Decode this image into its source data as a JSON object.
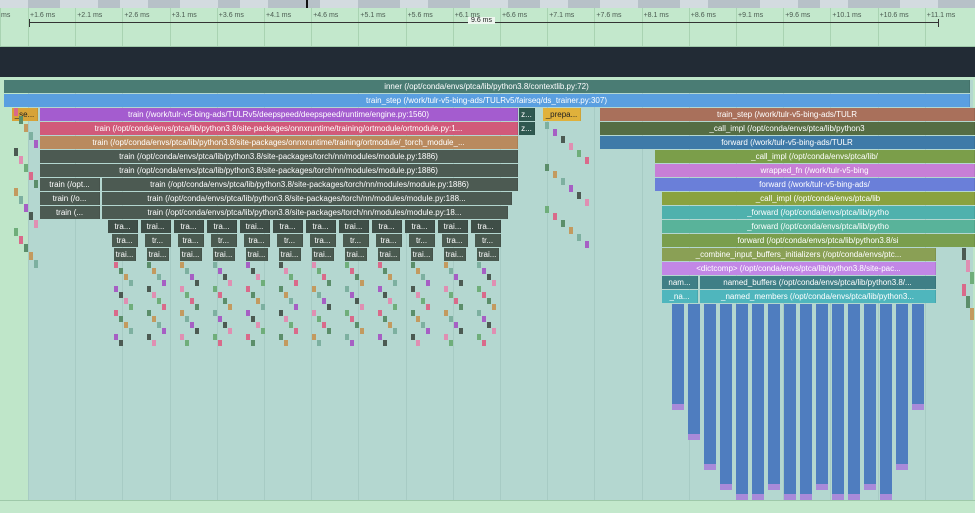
{
  "ruler": {
    "ticks": [
      "ms",
      "+1.6 ms",
      "+2.1 ms",
      "+2.6 ms",
      "+3.1 ms",
      "+3.6 ms",
      "+4.1 ms",
      "+4.6 ms",
      "+5.1 ms",
      "+5.6 ms",
      "+6.1 ms",
      "+6.6 ms",
      "+7.1 ms",
      "+7.6 ms",
      "+8.1 ms",
      "+8.6 ms",
      "+9.1 ms",
      "+9.6 ms",
      "+10.1 ms",
      "+10.6 ms",
      "+11.1 ms"
    ],
    "selection_label": "9.6 ms"
  },
  "frames": {
    "inner": "inner (/opt/conda/envs/ptca/lib/python3.8/contextlib.py:72)",
    "train_step_top": "train_step (/work/tulr-v5-bing-ads/TULRv5/fairseq/ds_trainer.py:307)",
    "se": "_se...",
    "train_engine": "train (/work/tulr-v5-bing-ads/TULRv5/deepspeed/deepspeed/runtime/engine.py:1560)",
    "z1": "z...",
    "prepa": "_prepa...",
    "train_step_right": "train_step (/work/tulr-v5-bing-ads/TULR",
    "train_ortmodule": "train (/opt/conda/envs/ptca/lib/python3.8/site-packages/onnxruntime/training/ortmodule/ortmodule.py:1...",
    "z2": "z...",
    "call_impl_1": "_call_impl (/opt/conda/envs/ptca/lib/python3",
    "train_torch_module": "train (/opt/conda/envs/ptca/lib/python3.8/site-packages/onnxruntime/training/ortmodule/_torch_module_...",
    "forward_1": "forward (/work/tulr-v5-bing-ads/TULR",
    "train_nn_1": "train (/opt/conda/envs/ptca/lib/python3.8/site-packages/torch/nn/modules/module.py:1886)",
    "call_impl_2": "_call_impl (/opt/conda/envs/ptca/lib/",
    "train_nn_2": "train (/opt/conda/envs/ptca/lib/python3.8/site-packages/torch/nn/modules/module.py:1886)",
    "wrapped_fn": "wrapped_fn (/work/tulr-v5-bing",
    "train_short_1": "train (/opt...",
    "train_nn_3": "train (/opt/conda/envs/ptca/lib/python3.8/site-packages/torch/nn/modules/module.py:1886)",
    "forward_2": "forward (/work/tulr-v5-bing-ads/",
    "train_short_2": "train (/o...",
    "train_nn_4": "train (/opt/conda/envs/ptca/lib/python3.8/site-packages/torch/nn/modules/module.py:188...",
    "call_impl_3": "_call_impl (/opt/conda/envs/ptca/lib",
    "train_short_3": "train (...",
    "train_nn_5": "train (/opt/conda/envs/ptca/lib/python3.8/site-packages/torch/nn/modules/module.py:18...",
    "forward_3": "_forward (/opt/conda/envs/ptca/lib/pytho",
    "forward_4": "_forward (/opt/conda/envs/ptca/lib/pytho",
    "forward_5": "forward (/opt/conda/envs/ptca/lib/python3.8/si",
    "combine": "_combine_input_buffers_initializers (/opt/conda/envs/ptc...",
    "dictcomp": "<dictcomp> (/opt/conda/envs/ptca/lib/python3.8/site-pac...",
    "nam_short": "nam...",
    "named_buffers": "named_buffers (/opt/conda/envs/ptca/lib/python3.8/...",
    "na_short": "_na...",
    "named_members": "_named_members (/opt/conda/envs/ptca/lib/python3...",
    "tra": "tra...",
    "trai": "trai...",
    "tr": "tr..."
  },
  "colors": {
    "inner": "#4a7c74",
    "train_step": "#5a9fe0",
    "engine": "#a45ccf",
    "ortmodule": "#d15a7a",
    "torch_module": "#b98a5e",
    "nn_module": "#4c5a52",
    "call_impl": "#7aa54e",
    "wrapped": "#c77fd6",
    "forward_blue": "#6a7fd9",
    "combine": "#8aa055",
    "dictcomp": "#c287e6",
    "named": "#3f7f86",
    "named_members": "#4fb6bd"
  }
}
